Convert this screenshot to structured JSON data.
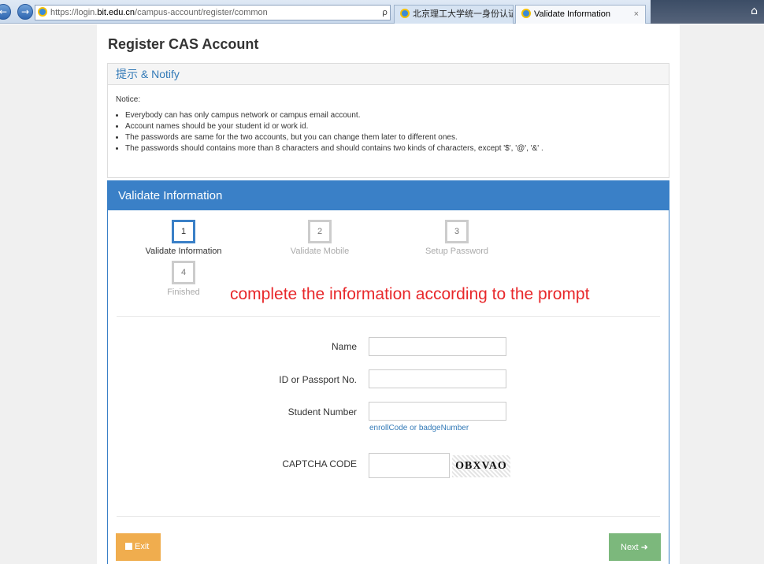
{
  "browser": {
    "url_prefix": "https://login.",
    "url_host": "bit.edu.cn",
    "url_path": "/campus-account/register/common",
    "address_tools": "ρ ▾ ▣ C",
    "tabs": [
      {
        "title": "北京理工大学统一身份认证登录"
      },
      {
        "title": "Validate Information",
        "close": "×"
      }
    ],
    "home_icon": "⌂"
  },
  "page": {
    "title": "Register CAS Account"
  },
  "notify": {
    "header": "提示 & Notify",
    "notice_label": "Notice:",
    "items": [
      "Everybody can has only campus network or campus email account.",
      "Account names should be your student id or work id.",
      "The passwords are same for the two accounts, but you can change them later to different ones.",
      "The passwords should contains more than 8 characters and should contains two kinds of characters, except '$', '@', '&' ."
    ]
  },
  "validate": {
    "header": "Validate Information",
    "steps": [
      {
        "number": "1",
        "label": "Validate Information",
        "active": true
      },
      {
        "number": "2",
        "label": "Validate Mobile",
        "active": false
      },
      {
        "number": "3",
        "label": "Setup Password",
        "active": false
      },
      {
        "number": "4",
        "label": "Finished",
        "active": false
      }
    ],
    "prompt": "complete the information according to the prompt"
  },
  "form": {
    "name_label": "Name",
    "name_value": "",
    "id_label": "ID or Passport No.",
    "id_value": "",
    "student_label": "Student Number",
    "student_value": "",
    "student_help": "enrollCode or badgeNumber",
    "captcha_label": "CAPTCHA CODE",
    "captcha_value": "",
    "captcha_image_text": "OBXVAO"
  },
  "buttons": {
    "exit": "Exit",
    "next": "Next"
  },
  "colors": {
    "primary": "#3a80c7",
    "warning": "#f0ad4e",
    "success": "#7cb87c",
    "prompt": "#e8282b"
  },
  "icons": {
    "exit": "square-icon",
    "next": "arrow-right-icon",
    "back": "back-arrow-icon",
    "forward": "forward-arrow-icon",
    "home": "home-icon"
  }
}
